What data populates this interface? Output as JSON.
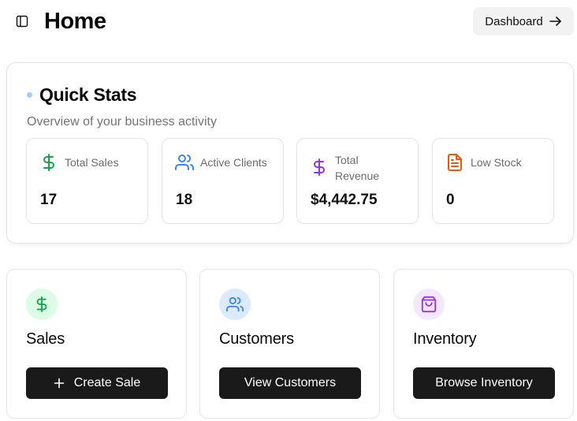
{
  "header": {
    "title": "Home",
    "dashboard_label": "Dashboard"
  },
  "quick_stats": {
    "title": "Quick Stats",
    "subtitle": "Overview of your business activity",
    "items": [
      {
        "label": "Total Sales",
        "value": "17",
        "icon": "dollar-icon",
        "color": "#16a34a"
      },
      {
        "label": "Active Clients",
        "value": "18",
        "icon": "users-icon",
        "color": "#3b82f6"
      },
      {
        "label": "Total Revenue",
        "value": "$4,442.75",
        "icon": "dollar-icon",
        "color": "#9333ea"
      },
      {
        "label": "Low Stock",
        "value": "0",
        "icon": "document-icon",
        "color": "#ea580c"
      }
    ]
  },
  "actions": [
    {
      "title": "Sales",
      "button": "Create Sale",
      "icon": "dollar-icon",
      "icon_color": "#16a34a",
      "icon_bg": "#dcfce7"
    },
    {
      "title": "Customers",
      "button": "View Customers",
      "icon": "users-icon",
      "icon_color": "#3b82f6",
      "icon_bg": "#dbeafe"
    },
    {
      "title": "Inventory",
      "button": "Browse Inventory",
      "icon": "shopping-bag-icon",
      "icon_color": "#9333ea",
      "icon_bg": "#f3e8ff"
    }
  ]
}
